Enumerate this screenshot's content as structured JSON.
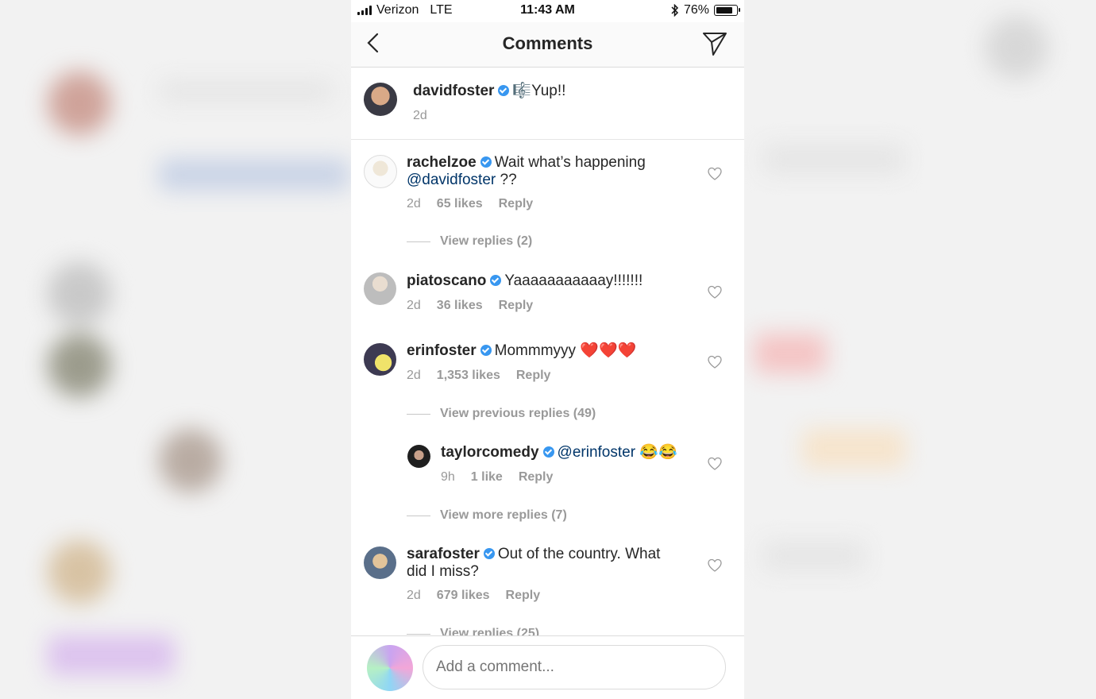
{
  "status_bar": {
    "carrier": "Verizon",
    "network": "LTE",
    "time": "11:43 AM",
    "battery": "76%"
  },
  "nav": {
    "title": "Comments"
  },
  "caption": {
    "username": "davidfoster",
    "text": "🎼Yup!!",
    "time": "2d"
  },
  "comments": [
    {
      "username": "rachelzoe",
      "text": "Wait what’s happening",
      "mention": "@davidfoster",
      "text_after": " ??",
      "time": "2d",
      "likes": "65 likes",
      "reply": "Reply",
      "view_replies": "View replies (2)"
    },
    {
      "username": "piatoscano",
      "text": "Yaaaaaaaaaaay!!!!!!!",
      "time": "2d",
      "likes": "36 likes",
      "reply": "Reply"
    },
    {
      "username": "erinfoster",
      "text": "Mommmyyy ❤️❤️❤️",
      "time": "2d",
      "likes": "1,353 likes",
      "reply": "Reply",
      "view_replies": "View previous replies (49)"
    },
    {
      "username": "taylorcomedy",
      "mention": "@erinfoster",
      "text": " 😂😂",
      "time": "9h",
      "likes": "1 like",
      "reply": "Reply",
      "view_replies": "View more replies (7)"
    },
    {
      "username": "sarafoster",
      "text": "Out of the country. What",
      "text2": "did I miss?",
      "time": "2d",
      "likes": "679 likes",
      "reply": "Reply",
      "view_replies": "View replies (25)"
    }
  ],
  "composer": {
    "placeholder": "Add a comment..."
  },
  "icons": {
    "back": "chevron-left-icon",
    "send": "paper-plane-icon",
    "like": "heart-outline-icon",
    "verified": "verified-badge-icon",
    "bluetooth": "bluetooth-icon",
    "battery": "battery-icon",
    "signal": "signal-bars-icon"
  },
  "colors": {
    "verified": "#3897f0",
    "mention": "#003569",
    "muted": "#999999"
  }
}
